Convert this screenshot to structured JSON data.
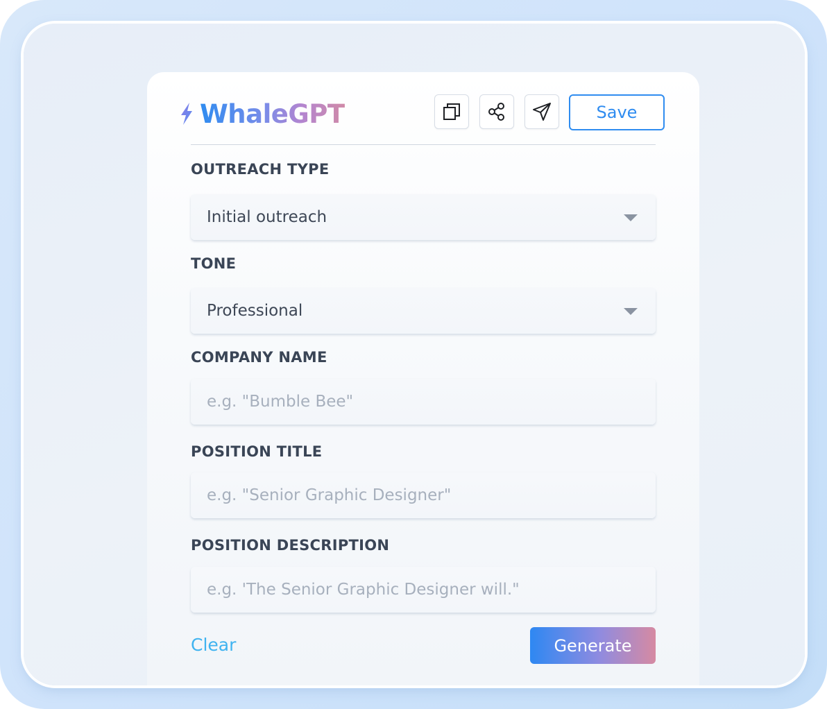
{
  "app": {
    "name": "WhaleGPT"
  },
  "toolbar": {
    "icons": [
      "copy-icon",
      "share-icon",
      "send-icon"
    ],
    "save_label": "Save"
  },
  "form": {
    "outreach_type": {
      "label": "OUTREACH TYPE",
      "value": "Initial outreach"
    },
    "tone": {
      "label": "TONE",
      "value": "Professional"
    },
    "company_name": {
      "label": "COMPANY NAME",
      "placeholder": "e.g. \"Bumble Bee\""
    },
    "position_title": {
      "label": "POSITION TITLE",
      "placeholder": "e.g. \"Senior Graphic Designer\""
    },
    "position_description": {
      "label": "POSITION DESCRIPTION",
      "placeholder": "e.g. 'The Senior Graphic Designer will.\""
    }
  },
  "actions": {
    "clear_label": "Clear",
    "generate_label": "Generate"
  },
  "colors": {
    "accent": "#2f8cf0",
    "clear_link": "#3fb3f0",
    "label_text": "#3a4556",
    "placeholder": "#a7b0bd"
  }
}
